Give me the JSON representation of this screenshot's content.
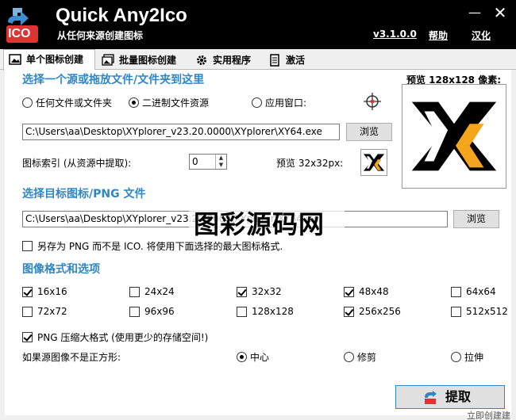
{
  "titlebar": {
    "title": "Quick Any2Ico",
    "subtitle": "从任何来源创建图标",
    "version": "v3.1.0.0",
    "help": "帮助",
    "localize": "汉化",
    "icon_text": "ICO"
  },
  "tabs": [
    {
      "label": "单个图标创建",
      "icon": "image-icon",
      "active": true
    },
    {
      "label": "批量图标创建",
      "icon": "images-icon",
      "active": false
    },
    {
      "label": "实用程序",
      "icon": "gear-icon",
      "active": false
    },
    {
      "label": "激活",
      "icon": "document-icon",
      "active": false
    }
  ],
  "source": {
    "title": "选择一个源或拖放文件/文件夹到这里",
    "options": [
      {
        "label": "任何文件或文件夹",
        "selected": false
      },
      {
        "label": "二进制文件资源",
        "selected": true
      },
      {
        "label": "应用窗口:",
        "selected": false
      }
    ],
    "path": "C:\\Users\\aa\\Desktop\\XYplorer_v23.20.0000\\XYplorer\\XY64.exe",
    "browse": "浏览",
    "index_label": "图标索引 (从资源中提取):",
    "index_value": "0",
    "preview_small_label": "预览 32x32px:",
    "preview_big_label": "预览 128x128 像素:"
  },
  "target": {
    "title": "选择目标图标/PNG 文件",
    "path": "C:\\Users\\aa\\Desktop\\XYplorer_v23.20.0000\\XYplorer\\XY64.ico",
    "browse": "浏览",
    "save_png": "另存为 PNG 而不是 ICO. 将使用下面选择的最大图标格式."
  },
  "formats": {
    "title": "图像格式和选项",
    "sizes": [
      {
        "label": "16x16",
        "checked": true
      },
      {
        "label": "24x24",
        "checked": false
      },
      {
        "label": "32x32",
        "checked": true
      },
      {
        "label": "48x48",
        "checked": true
      },
      {
        "label": "64x64",
        "checked": false
      },
      {
        "label": "72x72",
        "checked": false
      },
      {
        "label": "96x96",
        "checked": false
      },
      {
        "label": "128x128",
        "checked": false
      },
      {
        "label": "256x256",
        "checked": true
      },
      {
        "label": "512x512",
        "checked": false
      }
    ],
    "png_compress": "PNG 压缩大格式 (使用更少的存储空间!)",
    "not_square_label": "如果源图像不是正方形:",
    "fit_options": [
      {
        "label": "中心",
        "selected": true
      },
      {
        "label": "修剪",
        "selected": false
      },
      {
        "label": "拉伸",
        "selected": false
      }
    ]
  },
  "extract_button": "提取",
  "watermark_text": "图彩源码网",
  "corner_text": "立即创建建",
  "colors": {
    "accent": "#2f86c4",
    "titlebar": "#000000",
    "logo_orange": "#f5a51c"
  }
}
